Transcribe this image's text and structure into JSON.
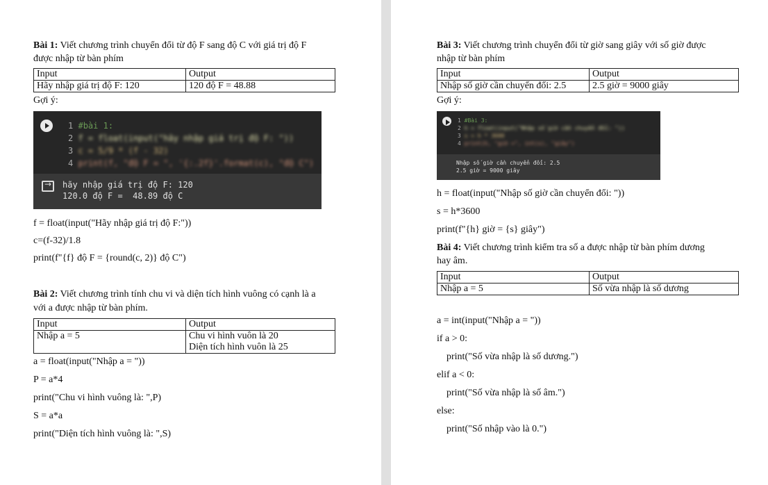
{
  "left": {
    "bai1": {
      "title": "Bài 1:",
      "desc_line1": " Viết chương trình chuyển đổi từ độ F sang độ C với giá trị độ F",
      "desc_line2": "được nhập từ bàn phím",
      "table": {
        "header": [
          "Input",
          "Output"
        ],
        "row": [
          "Hãy nhập giá trị độ F: 120",
          "120 độ F = 48.88"
        ]
      },
      "hint": "Gợi ý:",
      "notebook": {
        "lines": [
          {
            "num": "1",
            "text": "#bài 1:"
          },
          {
            "num": "2",
            "text": "f = float(input(\"hãy nhập giá trị độ F: \"))"
          },
          {
            "num": "3",
            "text": "c = 5/9 * (f - 32)"
          },
          {
            "num": "4",
            "text": "print(f, \"độ F = \", '{:.2f}'.format(c), \"độ C\")"
          }
        ],
        "output": [
          "hãy nhập giá trị độ F: 120",
          "120.0 độ F =  48.89 độ C"
        ]
      },
      "code": [
        "f = float(input(\"Hãy nhập giá trị độ F:\"))",
        "c=(f-32)/1.8",
        "print(f\"{f} độ F = {round(c, 2)} độ C\")"
      ]
    },
    "bai2": {
      "title": "Bài 2:",
      "desc_line1": " Viết chương trình tính chu vi và diện tích hình vuông có cạnh là a",
      "desc_line2": "với a được nhập từ bàn phím.",
      "table": {
        "header": [
          "Input",
          "Output"
        ],
        "input": "Nhập a = 5",
        "output1": "Chu vi hình vuôn là 20",
        "output2": "Diện tích hình vuôn là 25"
      },
      "code": [
        "a = float(input(\"Nhập a = \"))",
        "P = a*4",
        "print(\"Chu vi hình vuông là: \",P)",
        "S = a*a",
        "print(\"Diện tích hình vuông là: \",S)"
      ]
    }
  },
  "right": {
    "bai3": {
      "title": "Bài 3:",
      "desc_line1": " Viết chương trình chuyển đổi từ giờ sang giây với số giờ được",
      "desc_line2": "nhập từ bàn phím",
      "table": {
        "header": [
          "Input",
          "Output"
        ],
        "row": [
          "Nhập số giờ cần chuyển đổi: 2.5",
          "2.5 giờ = 9000 giây"
        ]
      },
      "hint": "Gợi ý:",
      "notebook": {
        "lines": [
          {
            "num": "1",
            "text": "#Bài 3:"
          },
          {
            "num": "2",
            "text": "h = float(input(\"Nhập số giờ cần chuyển đổi: \"))"
          },
          {
            "num": "3",
            "text": "s = h * 3600"
          },
          {
            "num": "4",
            "text": "print(h, \"giờ =\", int(s), \"giây\")"
          }
        ],
        "output": [
          "Nhập số giờ cần chuyển đổi: 2.5",
          "2.5 giờ = 9000 giây"
        ]
      },
      "code": [
        "h = float(input(\"Nhập số giờ cần chuyển đổi: \"))",
        "s = h*3600",
        "print(f\"{h} giờ = {s} giây\")"
      ]
    },
    "bai4": {
      "title": "Bài 4:",
      "desc_line1": " Viết chương trình kiểm tra số a được nhập từ bàn phím dương",
      "desc_line2": "hay âm.",
      "table": {
        "header": [
          "Input",
          "Output"
        ],
        "row": [
          "Nhập a = 5",
          "Số vừa nhập là số dương"
        ]
      },
      "code": [
        "a = int(input(\"Nhập a = \"))",
        "if a > 0:",
        "    print(\"Số vừa nhập là số dương.\")",
        "elif a < 0:",
        "    print(\"Số vừa nhập là số âm.\")",
        "else:",
        "    print(\"Số nhập vào là 0.\")"
      ]
    }
  }
}
